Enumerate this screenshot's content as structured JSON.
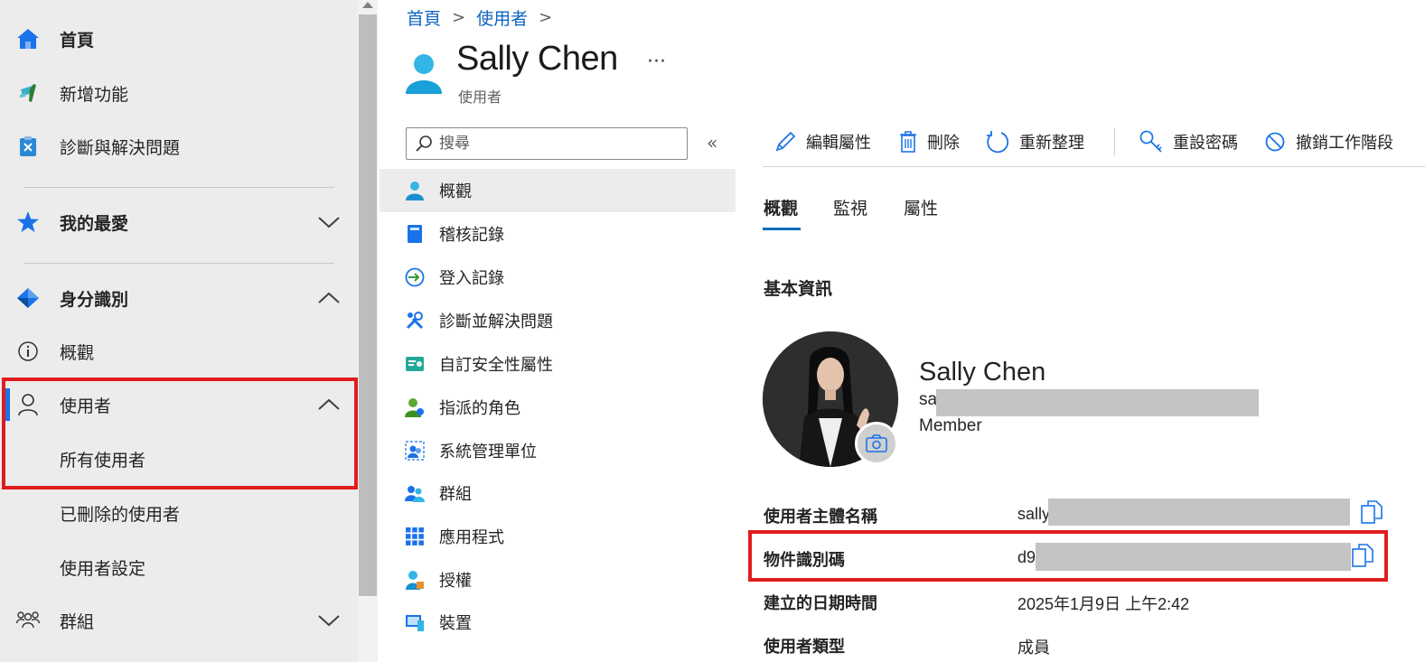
{
  "left_nav": {
    "items": [
      {
        "label": "首頁",
        "icon": "home-icon"
      },
      {
        "label": "新增功能",
        "icon": "whats-new-icon"
      },
      {
        "label": "診斷與解決問題",
        "icon": "diagnose-icon"
      },
      {
        "label": "我的最愛",
        "icon": "star-icon"
      },
      {
        "label": "身分識別",
        "icon": "identity-icon"
      },
      {
        "label": "概觀",
        "icon": "info-icon"
      },
      {
        "label": "使用者",
        "icon": "user-icon"
      },
      {
        "label": "所有使用者"
      },
      {
        "label": "已刪除的使用者"
      },
      {
        "label": "使用者設定"
      },
      {
        "label": "群組",
        "icon": "group-icon"
      }
    ]
  },
  "breadcrumb": {
    "items": [
      "首頁",
      "使用者"
    ],
    "separator": ">"
  },
  "header": {
    "title": "Sally Chen",
    "subtitle": "使用者",
    "more": "···"
  },
  "resource_menu": {
    "search_placeholder": "搜尋",
    "collapse": "«",
    "items": [
      {
        "label": "概觀",
        "icon": "user-overview-icon",
        "active": true
      },
      {
        "label": "稽核記錄",
        "icon": "audit-log-icon"
      },
      {
        "label": "登入記錄",
        "icon": "sign-in-log-icon"
      },
      {
        "label": "診斷並解決問題",
        "icon": "wrench-icon"
      },
      {
        "label": "自訂安全性屬性",
        "icon": "custom-attribute-icon"
      },
      {
        "label": "指派的角色",
        "icon": "assigned-roles-icon"
      },
      {
        "label": "系統管理單位",
        "icon": "admin-unit-icon"
      },
      {
        "label": "群組",
        "icon": "groups-icon"
      },
      {
        "label": "應用程式",
        "icon": "apps-grid-icon"
      },
      {
        "label": "授權",
        "icon": "license-icon"
      },
      {
        "label": "裝置",
        "icon": "device-icon"
      }
    ]
  },
  "toolbar": {
    "edit": "編輯屬性",
    "delete": "刪除",
    "refresh": "重新整理",
    "reset_password": "重設密碼",
    "revoke_sessions": "撤銷工作階段"
  },
  "tabs": [
    "概觀",
    "監視",
    "屬性"
  ],
  "section_title": "基本資訊",
  "profile": {
    "name": "Sally Chen",
    "email_prefix": "sally@",
    "role": "Member"
  },
  "properties": [
    {
      "label": "使用者主體名稱",
      "value": "sally"
    },
    {
      "label": "物件識別碼",
      "value": "d9"
    },
    {
      "label": "建立的日期時間",
      "value": "2025年1月9日 上午2:42"
    },
    {
      "label": "使用者類型",
      "value": "成員"
    }
  ],
  "colors": {
    "accent": "#0f6cbd",
    "highlight": "#e01d1d",
    "nav_bg": "#ececec"
  }
}
